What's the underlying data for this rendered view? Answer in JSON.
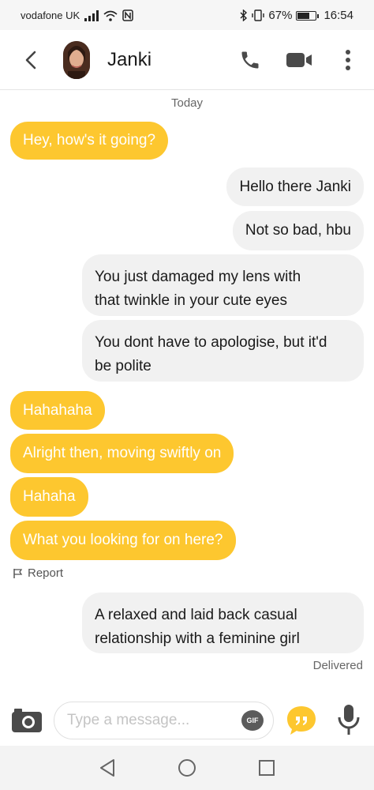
{
  "status_bar": {
    "carrier": "vodafone UK",
    "battery_percent": "67%",
    "battery_level": 0.67,
    "time": "16:54"
  },
  "header": {
    "contact_name": "Janki",
    "icons": [
      "back-icon",
      "phone-icon",
      "video-icon",
      "more-vert-icon"
    ]
  },
  "chat": {
    "date_label": "Today",
    "messages": [
      {
        "direction": "in",
        "text": "Hey, how's it going?"
      },
      {
        "direction": "out",
        "text": "Hello there Janki"
      },
      {
        "direction": "out",
        "text": "Not so bad, hbu"
      },
      {
        "direction": "out",
        "lines": [
          "You just damaged my lens with",
          "that twinkle in your cute eyes"
        ]
      },
      {
        "direction": "out",
        "lines": [
          "You dont have to apologise, but it'd",
          "be polite"
        ]
      },
      {
        "direction": "in",
        "text": "Hahahaha"
      },
      {
        "direction": "in",
        "text": "Alright then, moving swiftly on"
      },
      {
        "direction": "in",
        "text": "Hahaha"
      },
      {
        "direction": "in",
        "text": "What you looking for on here?"
      },
      {
        "direction": "out",
        "lines": [
          "A relaxed and laid back casual",
          "relationship with a feminine girl"
        ]
      }
    ],
    "report_label": "Report",
    "delivered_label": "Delivered"
  },
  "composer": {
    "placeholder": "Type a message...",
    "gif_label": "GIF"
  },
  "colors": {
    "incoming_bubble": "#fdc72f",
    "outgoing_bubble": "#f1f1f1",
    "accent": "#fdc72f"
  }
}
